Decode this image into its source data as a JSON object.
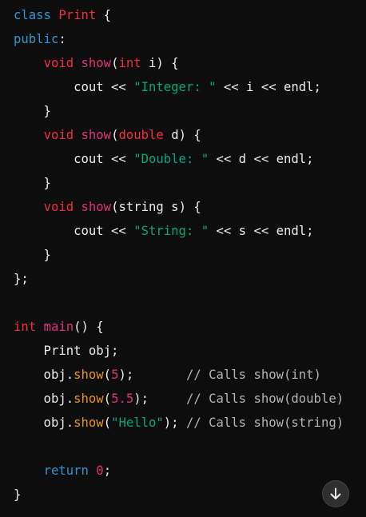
{
  "code": {
    "language": "cpp",
    "lines": [
      [
        {
          "t": "class ",
          "k": "keyword"
        },
        {
          "t": "Print",
          "k": "type"
        },
        {
          "t": " {",
          "k": "plain"
        }
      ],
      [
        {
          "t": "public",
          "k": "keyword"
        },
        {
          "t": ":",
          "k": "plain"
        }
      ],
      [
        {
          "t": "    ",
          "k": "plain"
        },
        {
          "t": "void",
          "k": "type"
        },
        {
          "t": " ",
          "k": "plain"
        },
        {
          "t": "show",
          "k": "func"
        },
        {
          "t": "(",
          "k": "plain"
        },
        {
          "t": "int",
          "k": "type"
        },
        {
          "t": " i) {",
          "k": "plain"
        }
      ],
      [
        {
          "t": "        cout << ",
          "k": "plain"
        },
        {
          "t": "\"Integer: \"",
          "k": "string"
        },
        {
          "t": " << i << endl;",
          "k": "plain"
        }
      ],
      [
        {
          "t": "    }",
          "k": "plain"
        }
      ],
      [
        {
          "t": "    ",
          "k": "plain"
        },
        {
          "t": "void",
          "k": "type"
        },
        {
          "t": " ",
          "k": "plain"
        },
        {
          "t": "show",
          "k": "func"
        },
        {
          "t": "(",
          "k": "plain"
        },
        {
          "t": "double",
          "k": "type"
        },
        {
          "t": " d) {",
          "k": "plain"
        }
      ],
      [
        {
          "t": "        cout << ",
          "k": "plain"
        },
        {
          "t": "\"Double: \"",
          "k": "string"
        },
        {
          "t": " << d << endl;",
          "k": "plain"
        }
      ],
      [
        {
          "t": "    }",
          "k": "plain"
        }
      ],
      [
        {
          "t": "    ",
          "k": "plain"
        },
        {
          "t": "void",
          "k": "type"
        },
        {
          "t": " ",
          "k": "plain"
        },
        {
          "t": "show",
          "k": "func"
        },
        {
          "t": "(string s) {",
          "k": "plain"
        }
      ],
      [
        {
          "t": "        cout << ",
          "k": "plain"
        },
        {
          "t": "\"String: \"",
          "k": "string"
        },
        {
          "t": " << s << endl;",
          "k": "plain"
        }
      ],
      [
        {
          "t": "    }",
          "k": "plain"
        }
      ],
      [
        {
          "t": "};",
          "k": "plain"
        }
      ],
      [],
      [
        {
          "t": "int",
          "k": "type"
        },
        {
          "t": " ",
          "k": "plain"
        },
        {
          "t": "main",
          "k": "func"
        },
        {
          "t": "() {",
          "k": "plain"
        }
      ],
      [
        {
          "t": "    Print obj;",
          "k": "plain"
        }
      ],
      [
        {
          "t": "    obj.",
          "k": "plain"
        },
        {
          "t": "show",
          "k": "method"
        },
        {
          "t": "(",
          "k": "plain"
        },
        {
          "t": "5",
          "k": "number"
        },
        {
          "t": ");       ",
          "k": "plain"
        },
        {
          "t": "// Calls show(int)",
          "k": "comment"
        }
      ],
      [
        {
          "t": "    obj.",
          "k": "plain"
        },
        {
          "t": "show",
          "k": "method"
        },
        {
          "t": "(",
          "k": "plain"
        },
        {
          "t": "5.5",
          "k": "number"
        },
        {
          "t": ");     ",
          "k": "plain"
        },
        {
          "t": "// Calls show(double)",
          "k": "comment"
        }
      ],
      [
        {
          "t": "    obj.",
          "k": "plain"
        },
        {
          "t": "show",
          "k": "method"
        },
        {
          "t": "(",
          "k": "plain"
        },
        {
          "t": "\"Hello\"",
          "k": "string"
        },
        {
          "t": "); ",
          "k": "plain"
        },
        {
          "t": "// Calls show(string)",
          "k": "comment"
        }
      ],
      [],
      [
        {
          "t": "    ",
          "k": "plain"
        },
        {
          "t": "return",
          "k": "keyword"
        },
        {
          "t": " ",
          "k": "plain"
        },
        {
          "t": "0",
          "k": "number"
        },
        {
          "t": ";",
          "k": "plain"
        }
      ],
      [
        {
          "t": "}",
          "k": "plain"
        }
      ]
    ]
  },
  "scroll_button": {
    "icon": "arrow-down-icon",
    "icon_color": "#ececec"
  },
  "theme": {
    "background": "#0d0d0d",
    "keyword": "#2e95d3",
    "type": "#f22c3d",
    "function": "#df3079",
    "string": "#00a67d",
    "method": "#e9950c",
    "comment": "#b4b4b4",
    "text": "#ececec"
  }
}
